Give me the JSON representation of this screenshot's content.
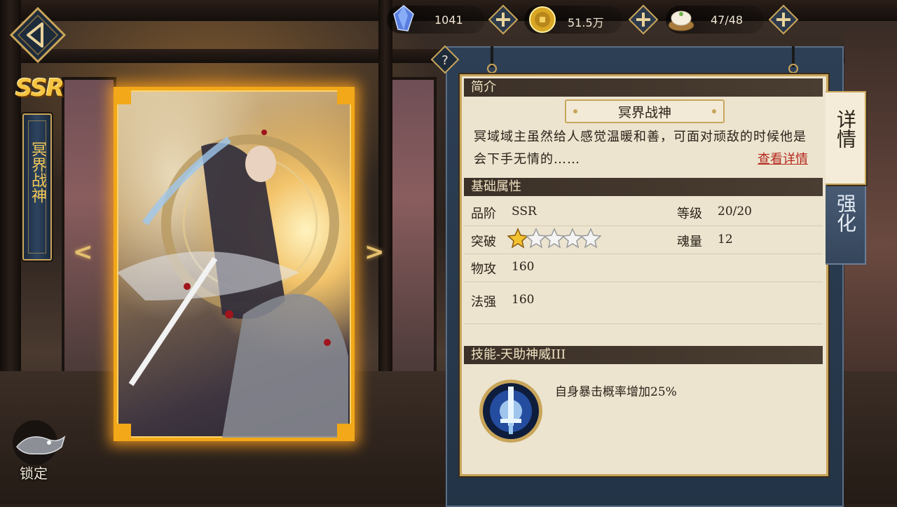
{
  "resources": {
    "gems": {
      "icon": "crystal-icon",
      "value": "1041"
    },
    "coins": {
      "icon": "gold-coin-icon",
      "value": "51.5万"
    },
    "stamina": {
      "icon": "bun-basket-icon",
      "value": "47/48"
    }
  },
  "hero": {
    "rarity": "SSR",
    "name": "冥界战神"
  },
  "nav": {
    "prev": "<",
    "next": ">",
    "lock_label": "锁定"
  },
  "panel": {
    "help": "?",
    "intro_header": "简介",
    "title": "冥界战神",
    "intro_text": "冥域域主虽然给人感觉温暖和善，可面对顽敌的时候他是会下手无情的……",
    "detail_link": "查看详情",
    "attr_header": "基础属性",
    "attrs": {
      "grade_label": "品阶",
      "grade_value": "SSR",
      "level_label": "等级",
      "level_value": "20/20",
      "break_label": "突破",
      "break_stars": 1,
      "break_max": 5,
      "soul_label": "魂量",
      "soul_value": "12",
      "phys_label": "物攻",
      "phys_value": "160",
      "magic_label": "法强",
      "magic_value": "160"
    },
    "skill_header": "技能-天助神威III",
    "skill_desc": "自身暴击概率增加25%"
  },
  "tabs": {
    "details": "详情",
    "enhance": "强化"
  },
  "colors": {
    "accent_gold": "#c9a55a",
    "card_border": "#f2a818",
    "link_red": "#b5281e",
    "panel_blue": "#2d3f55"
  }
}
